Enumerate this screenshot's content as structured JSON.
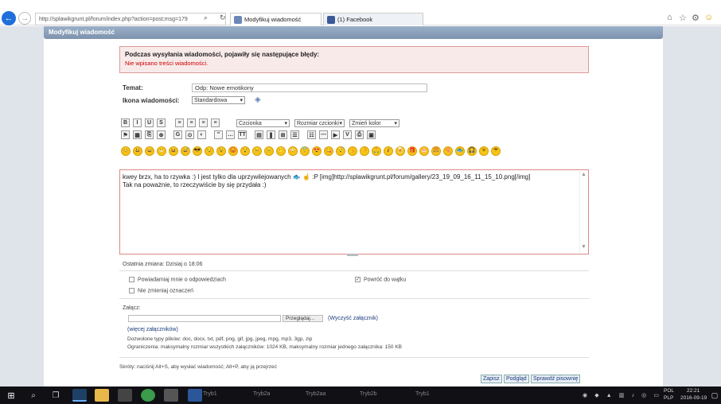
{
  "browser": {
    "address": "http://splawikgrunt.pl/forum/index.php?action=post;msg=179",
    "tabs": [
      {
        "label": "Modyfikuj wiadomość"
      },
      {
        "label": "(1) Facebook"
      }
    ]
  },
  "header": {
    "title": "Modyfikuj wiadomość"
  },
  "error": {
    "title": "Podczas wysyłania wiadomości, pojawiły się następujące błędy:",
    "message": "Nie wpisano treści wiadomości."
  },
  "form": {
    "subject_label": "Temat:",
    "subject_value": "Odp: Nowe emotikony",
    "icon_label": "Ikona wiadomości:",
    "icon_value": "Standardowa",
    "face_select": "Czcionka",
    "size_select": "Rozmiar czcionki",
    "color_select": "Zmień kolor",
    "body_line1": "kwey brzx, ha to rzywka :) I jest tylko dla uprzywilejowanych 🐟 ☝ :P [img]http://splawikgrunt.pl/forum/gallery/23_19_09_16_11_15_10.png[/img]",
    "body_line2": "Tak na poważnie, to rzeczywiście by się przydała :)"
  },
  "toolbar": {
    "row1": [
      "B",
      "I",
      "U",
      "S",
      "≡",
      "≡",
      "≡",
      "≡"
    ],
    "row2": [
      "⚑",
      "▦",
      "⎘",
      "⊕",
      "G",
      "⊙",
      "◐",
      "\"",
      "…",
      "TT",
      "▤",
      "❚",
      "⊞",
      "☰",
      "☷",
      "—",
      "▶",
      "V",
      "⎙",
      "▣"
    ],
    "emoticons": [
      "😊",
      "😃",
      "😄",
      "😁",
      "😆",
      "😅",
      "😎",
      "😏",
      "😉",
      "😡",
      "😯",
      "😐",
      "😑",
      "😶",
      "😳",
      "😇",
      "😍",
      "😋",
      "😴",
      "👍",
      "👎",
      "🙏",
      "💰",
      "🍺",
      "🎁",
      "🎂",
      "🍔",
      "🍕",
      "🐟",
      "🎧",
      "☀",
      "☂"
    ]
  },
  "info": {
    "last_edit": "Ostatnia zmiana: Dzisiaj o 18:06",
    "opt_notify": "Powiadamiaj mnie o odpowiedziach",
    "opt_return": "Powróć do wątku",
    "opt_noedit": "Nie zmieniaj oznaczeń",
    "attach_label": "Załącz:",
    "browse": "Przeglądaj...",
    "clear": "(Wyczyść załącznik)",
    "more": "(więcej załączników)",
    "allowed": "Dozwolone typy plików: doc, docx, txt, pdf, png, gif, jpg, jpeg, mpg, mp3, 3gp, zip",
    "limits": "Ograniczenia: maksymalny rozmiar wszystkich załączników: 1024 KB, maksymalny rozmiar jednego załącznika: 150 KB",
    "shortcuts": "Skróty: naciśnij Alt+S, aby wysłać wiadomość; Alt+P, aby ją przejrzeć"
  },
  "buttons": {
    "save": "Zapisz",
    "preview": "Podgląd",
    "spell": "Sprawdź pisownię"
  },
  "taskbar": {
    "apps": [
      "Tryb1",
      "Tryb2a",
      "Tryb2aa",
      "Tryb2b",
      "Tryb1"
    ],
    "lang": "POL",
    "layout": "PLP",
    "time": "22:21",
    "date": "2016-09-19"
  }
}
